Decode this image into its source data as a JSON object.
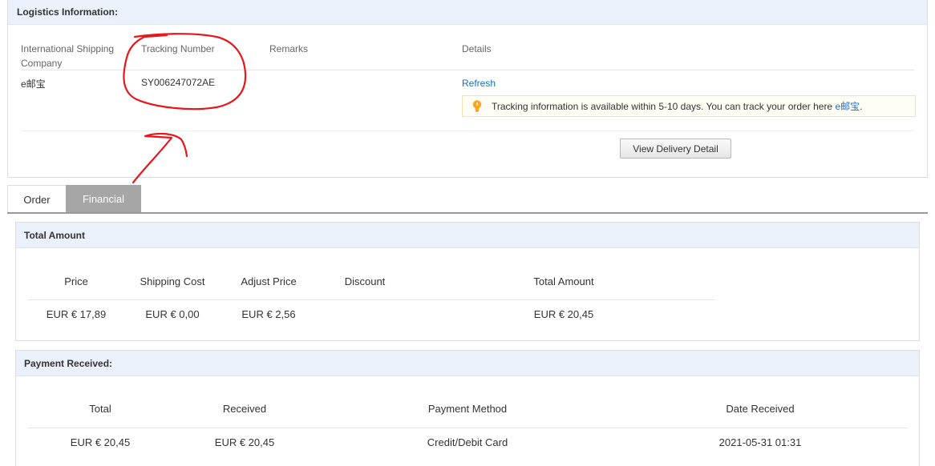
{
  "logistics": {
    "title": "Logistics Information:",
    "columns": {
      "company": "International Shipping Company",
      "tracking": "Tracking Number",
      "remarks": "Remarks",
      "details": "Details"
    },
    "row": {
      "company": "e邮宝",
      "tracking": "SY006247072AE",
      "remarks": "",
      "refresh_label": "Refresh"
    },
    "tip": {
      "text": "Tracking information is available within 5-10 days. You can track your order here ",
      "link": "e邮宝",
      "end": "."
    },
    "view_delivery_button": "View Delivery Detail"
  },
  "tabs": [
    {
      "label": "Order",
      "active": false
    },
    {
      "label": "Financial",
      "active": true
    }
  ],
  "total_amount": {
    "title": "Total Amount",
    "headers": [
      "Price",
      "Shipping Cost",
      "Adjust Price",
      "Discount",
      "Total Amount"
    ],
    "values": [
      "EUR € 17,89",
      "EUR € 0,00",
      "EUR € 2,56",
      "",
      "EUR € 20,45"
    ]
  },
  "payment_received": {
    "title": "Payment Received:",
    "headers": [
      "Total",
      "Received",
      "Payment Method",
      "Date Received"
    ],
    "values": [
      "EUR € 20,45",
      "EUR € 20,45",
      "Credit/Debit Card",
      "2021-05-31 01:31"
    ]
  },
  "colors": {
    "header_bg": "#eaf1fb",
    "link": "#1a6fc4",
    "active_tab": "#a6a6a6",
    "annotation": "#e8161a",
    "tip_icon": "#f5a623"
  },
  "icons": {
    "tip": "lightbulb-icon"
  }
}
